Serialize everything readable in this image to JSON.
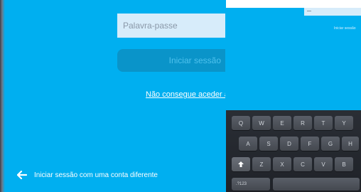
{
  "login": {
    "password_placeholder": "Palavra-passe",
    "signin_label": "Iniciar sessão",
    "cant_access_link": "Não consegue aceder à sua conta?",
    "different_account_label": "Iniciar sessão com uma conta diferente"
  },
  "right_panel": {
    "signin_label": "Iniciar sessão"
  },
  "keyboard": {
    "row1": [
      "Q",
      "W",
      "E",
      "R",
      "T",
      "Y"
    ],
    "row2": [
      "A",
      "S",
      "D",
      "F",
      "G",
      "H"
    ],
    "row3": [
      "Z",
      "X",
      "C",
      "V",
      "B"
    ],
    "numbers_key": ".?123",
    "shift_icon": "shift-up-arrow-icon"
  },
  "colors": {
    "background": "#00aff0",
    "field": "#d7ecfa",
    "button": "#0a94c9",
    "keyboard": "#2a2e35"
  }
}
